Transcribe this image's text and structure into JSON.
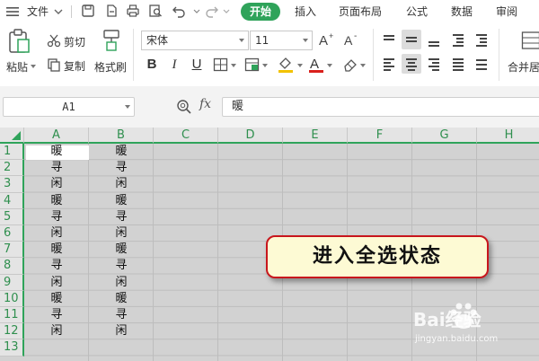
{
  "menubar": {
    "file_label": "文件",
    "tabs": [
      "开始",
      "插入",
      "页面布局",
      "公式",
      "数据",
      "审阅"
    ],
    "active_tab": "开始"
  },
  "ribbon": {
    "paste_label": "粘贴",
    "cut_label": "剪切",
    "copy_label": "复制",
    "format_painter_label": "格式刷",
    "font_name": "宋体",
    "font_size": "11",
    "merge_label": "合并居"
  },
  "formula_bar": {
    "name_box": "A1",
    "fx_label": "fx",
    "formula": "暖"
  },
  "grid": {
    "columns": [
      "A",
      "B",
      "C",
      "D",
      "E",
      "F",
      "G",
      "H"
    ],
    "rows": [
      "1",
      "2",
      "3",
      "4",
      "5",
      "6",
      "7",
      "8",
      "9",
      "10",
      "11",
      "12",
      "13"
    ],
    "col_a": [
      "暖",
      "寻",
      "闲",
      "暖",
      "寻",
      "闲",
      "暖",
      "寻",
      "闲",
      "暖",
      "寻",
      "闲"
    ],
    "col_b": [
      "暖",
      "寻",
      "闲",
      "暖",
      "寻",
      "闲",
      "暖",
      "寻",
      "闲",
      "暖",
      "寻",
      "闲"
    ]
  },
  "callout": {
    "text": "进入全选状态"
  },
  "watermark": {
    "brand": "Bai经验",
    "url": "jingyan.baidu.com"
  },
  "colors": {
    "accent": "#2fa35a",
    "selection_gray": "#d2d2d2",
    "callout_border": "#c8161d",
    "callout_fill": "#fdfad4"
  }
}
